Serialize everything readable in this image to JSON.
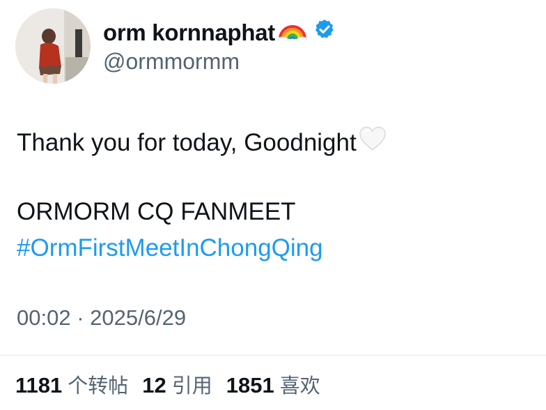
{
  "author": {
    "display_name": "orm kornnaphat",
    "handle": "@ormmormm",
    "avatar_icon": "profile-photo",
    "name_emoji": "rainbow-icon",
    "verified_badge": "verified-icon",
    "verified_color": "#1d9bf0"
  },
  "tweet": {
    "line1": "Thank you for today, Goodnight",
    "line1_emoji": "white-heart-icon",
    "line2": "ORMORM CQ FANMEET",
    "hashtag": "#OrmFirstMeetInChongQing",
    "hashtag_color": "#1d9bf0"
  },
  "meta": {
    "time": "00:02",
    "separator": "·",
    "date": "2025/6/29"
  },
  "stats": {
    "retweets_count": "1181",
    "retweets_label": "个转帖",
    "quotes_count": "12",
    "quotes_label": "引用",
    "likes_count": "1851",
    "likes_label": "喜欢"
  }
}
